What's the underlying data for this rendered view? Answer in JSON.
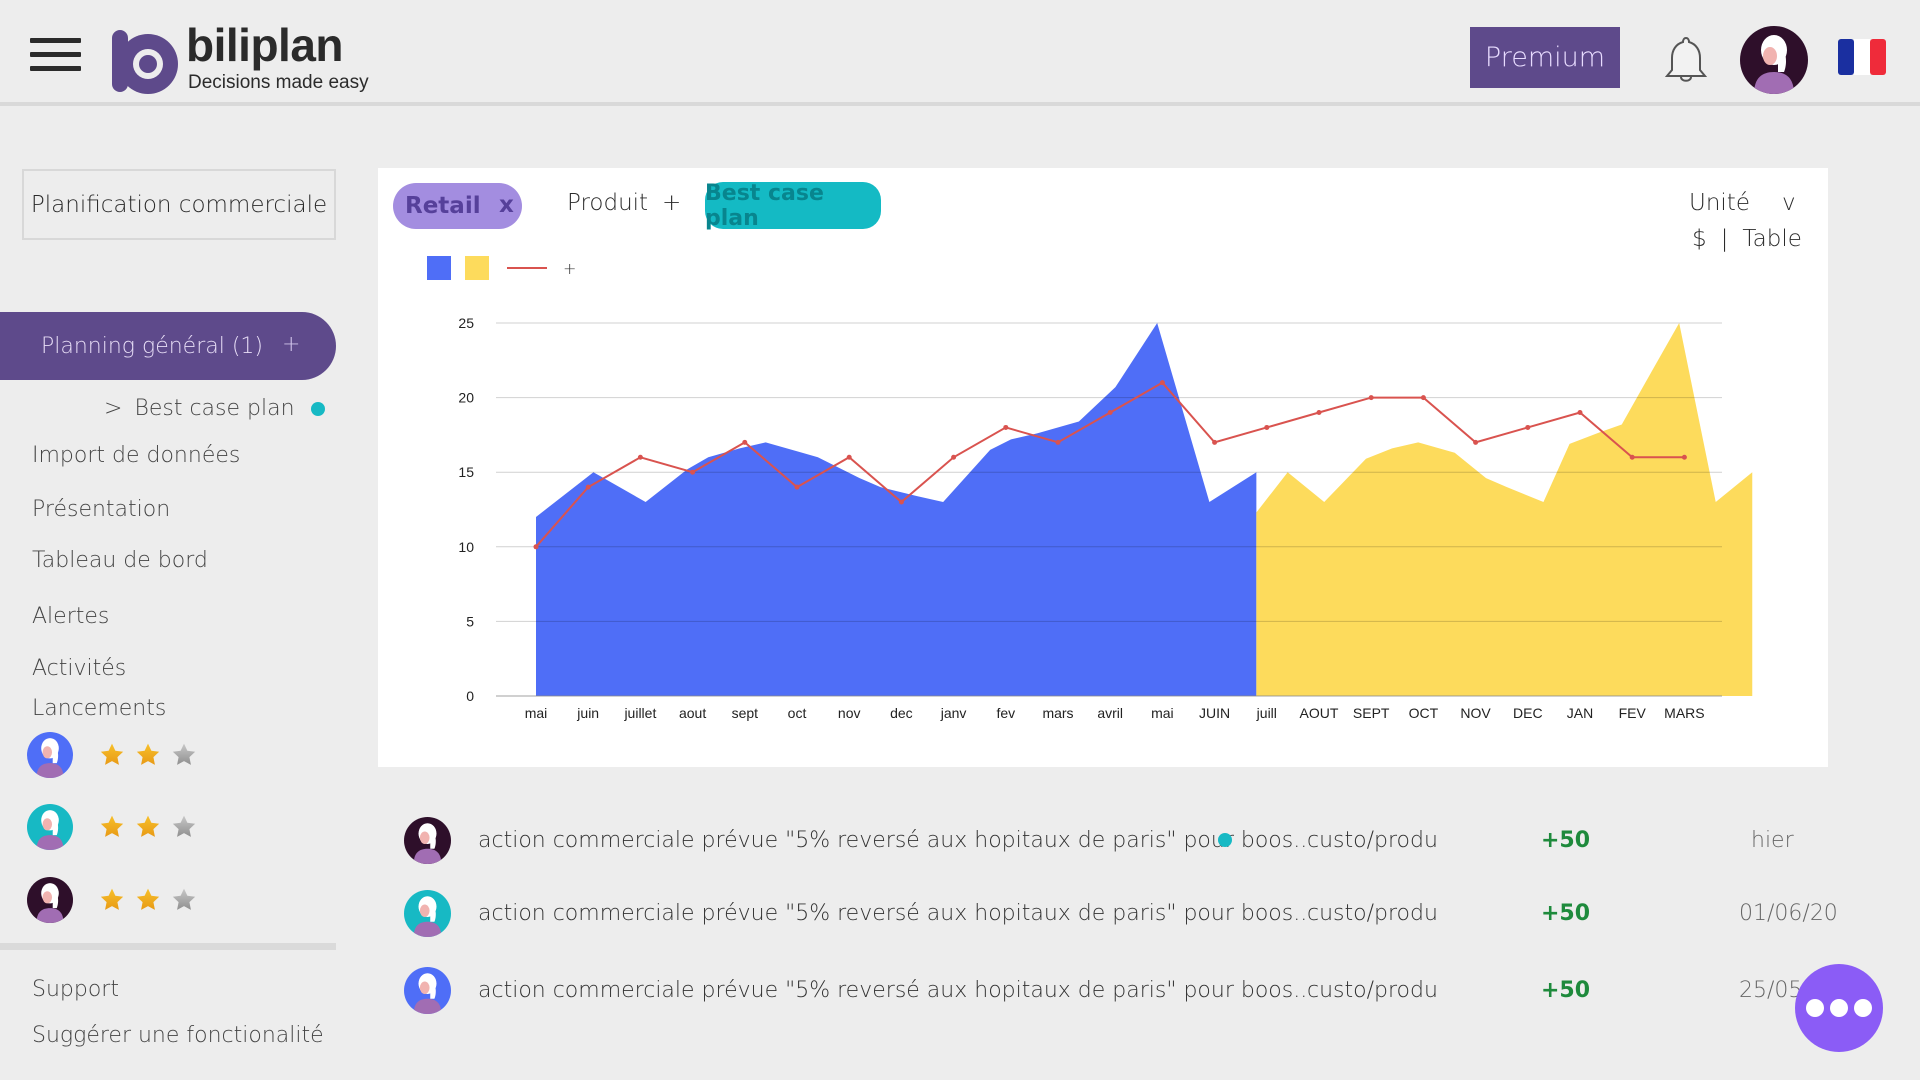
{
  "header": {
    "brand_name": "biliplan",
    "brand_tagline": "Decisions made easy",
    "premium_label": "Premium",
    "language": "fr",
    "icons": {
      "menu": "hamburger-icon",
      "notifications": "bell-icon",
      "avatar": "user-avatar",
      "language": "french-flag-icon"
    }
  },
  "colors": {
    "brand_purple": "#5e4a8b",
    "chip_retail_bg": "#a38de0",
    "chip_best_bg": "#14bac4",
    "series_actual": "#4f6ef7",
    "series_forecast": "#fddb5c",
    "series_line": "#d9534f",
    "positive": "#1e8a3c",
    "fab": "#8b5cf6"
  },
  "sidebar": {
    "project": "Planification commerciale",
    "active_plan": {
      "label": "Planning général (1)",
      "add": "+"
    },
    "sub_plan": {
      "prefix": ">",
      "label": "Best case plan"
    },
    "items": [
      {
        "label": "Import de données"
      },
      {
        "label": "Présentation"
      },
      {
        "label": "Tableau de bord"
      },
      {
        "label": "Alertes"
      },
      {
        "label": "Activités"
      },
      {
        "label": "Lancements"
      }
    ],
    "launches": [
      {
        "avatar_color": "#4f6ef7",
        "rating": 2,
        "max": 3
      },
      {
        "avatar_color": "#17b9c4",
        "rating": 2,
        "max": 3
      },
      {
        "avatar_color": "#2e0f2a",
        "rating": 2,
        "max": 3
      }
    ],
    "footer": [
      {
        "label": "Support"
      },
      {
        "label": "Suggérer une fonctionalité"
      }
    ]
  },
  "toolbar": {
    "filter_chip": {
      "label": "Retail",
      "remove": "x"
    },
    "dimension": {
      "label": "Produit",
      "add": "+"
    },
    "scenario_chip": "Best case plan",
    "unit_label": "Unité",
    "unit_chevron": "v",
    "unit_value": "$",
    "unit_sep": "|",
    "view_mode": "Table",
    "legend_add": "+"
  },
  "chart_data": {
    "type": "area",
    "title": "",
    "xlabel": "",
    "ylabel": "",
    "ylim": [
      0,
      25
    ],
    "yticks": [
      0,
      5,
      10,
      15,
      20,
      25
    ],
    "grid": true,
    "legend_position": "top-left",
    "categories": [
      "mai",
      "juin",
      "juillet",
      "aout",
      "sept",
      "oct",
      "nov",
      "dec",
      "janv",
      "fev",
      "mars",
      "avril",
      "mai",
      "JUIN",
      "juill",
      "AOUT",
      "SEPT",
      "OCT",
      "NOV",
      "DEC",
      "JAN",
      "FEV",
      "MARS"
    ],
    "series": [
      {
        "name": "actual",
        "kind": "area",
        "color": "#4f6ef7",
        "points": [
          [
            0,
            12
          ],
          [
            1.1,
            15
          ],
          [
            2.1,
            13
          ],
          [
            2.9,
            15.2
          ],
          [
            3.3,
            16
          ],
          [
            3.9,
            16.6
          ],
          [
            4.4,
            17
          ],
          [
            5.1,
            16.3
          ],
          [
            5.4,
            16
          ],
          [
            6.2,
            14.6
          ],
          [
            6.6,
            14
          ],
          [
            7.3,
            13.4
          ],
          [
            7.8,
            13
          ],
          [
            8.7,
            16.5
          ],
          [
            9.1,
            17.2
          ],
          [
            9.6,
            17.6
          ],
          [
            10.4,
            18.4
          ],
          [
            11.1,
            20.7
          ],
          [
            11.9,
            25
          ],
          [
            12.9,
            13
          ],
          [
            13.8,
            15
          ]
        ]
      },
      {
        "name": "forecast",
        "kind": "area",
        "color": "#fddb5c",
        "points": [
          [
            13.8,
            12.3
          ],
          [
            14.4,
            15
          ],
          [
            15.1,
            13
          ],
          [
            15.9,
            15.9
          ],
          [
            16.4,
            16.6
          ],
          [
            16.9,
            17
          ],
          [
            17.6,
            16.3
          ],
          [
            18.2,
            14.6
          ],
          [
            18.6,
            14
          ],
          [
            19.3,
            13
          ],
          [
            19.8,
            16.9
          ],
          [
            20.4,
            17.7
          ],
          [
            20.8,
            18.2
          ],
          [
            21.3,
            21.3
          ],
          [
            21.9,
            25
          ],
          [
            22.6,
            13
          ],
          [
            23.3,
            15
          ]
        ]
      },
      {
        "name": "trend",
        "kind": "line",
        "color": "#d9534f",
        "values": [
          10,
          14,
          16,
          15,
          17,
          14,
          16,
          13,
          16,
          18,
          17,
          19,
          21,
          17,
          18,
          19,
          20,
          20,
          17,
          18,
          19,
          16,
          16
        ]
      }
    ]
  },
  "activities": [
    {
      "avatar_color": "#2e0f2a",
      "text": "action commerciale prévue \"5% reversé aux hopitaux de paris\" pour boos..",
      "unread": true,
      "category": "custo/produ",
      "score": "+50",
      "date": "hier"
    },
    {
      "avatar_color": "#17b9c4",
      "text": "action commerciale prévue \"5% reversé aux hopitaux de paris\" pour boos..",
      "unread": false,
      "category": "custo/produ",
      "score": "+50",
      "date": "01/06/20"
    },
    {
      "avatar_color": "#4f6ef7",
      "text": "action commerciale prévue \"5% reversé aux hopitaux de paris\" pour boos..",
      "unread": false,
      "category": "custo/produ",
      "score": "+50",
      "date": "25/05/20"
    }
  ],
  "fab": {
    "icon": "more-icon"
  }
}
